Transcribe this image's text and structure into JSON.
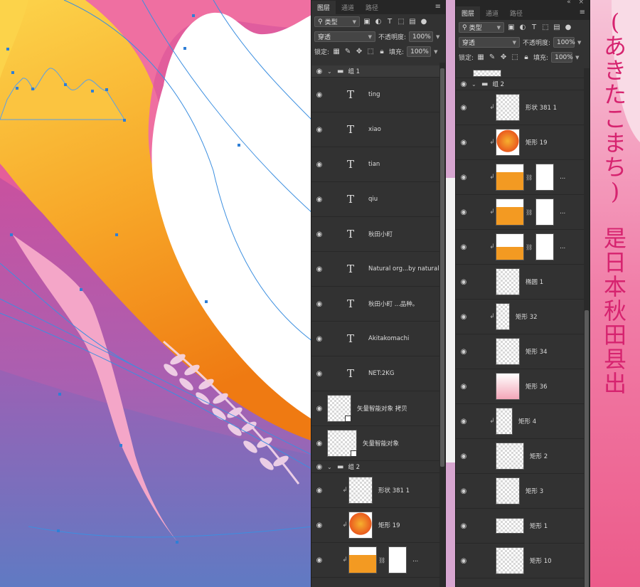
{
  "colors": {
    "accent_text": "#d6236f",
    "panel_bg": "#323232"
  },
  "left_panel": {
    "tabs": [
      "图层",
      "通道",
      "路径"
    ],
    "filter_kind": "类型",
    "blend_mode": "穿透",
    "opacity_label": "不透明度:",
    "opacity_value": "100%",
    "lock_label": "锁定:",
    "fill_label": "填充:",
    "fill_value": "100%",
    "group1_name": "组 1",
    "text_layers": [
      "ting",
      "xiao",
      "tian",
      "qiu",
      "秋田小町",
      "Natural org...by natural",
      "秋田小町 ...品种。",
      "Akitakomachi",
      "NET:2KG"
    ],
    "smart_layers": [
      "矢量智能对象 拷贝",
      "矢量智能对象"
    ],
    "group2_name": "组 2",
    "group2_layers": [
      {
        "name": "形状 381 1"
      },
      {
        "name": "矩形 19"
      },
      {
        "name": "..."
      }
    ]
  },
  "right_panel": {
    "tabs": [
      "图层",
      "通道",
      "路径"
    ],
    "filter_kind": "类型",
    "blend_mode": "穿透",
    "opacity_label": "不透明度:",
    "opacity_value": "100%",
    "lock_label": "锁定:",
    "fill_label": "填充:",
    "fill_value": "100%",
    "group2_name": "组 2",
    "layers": [
      {
        "name": "形状 381 1"
      },
      {
        "name": "矩形 19"
      },
      {
        "name": "..."
      },
      {
        "name": "..."
      },
      {
        "name": "..."
      },
      {
        "name": "椭圆 1"
      },
      {
        "name": "矩形 32"
      },
      {
        "name": "矩形 34"
      },
      {
        "name": "矩形 36"
      },
      {
        "name": "矩形 4"
      },
      {
        "name": "矩形 2"
      },
      {
        "name": "矩形 3"
      },
      {
        "name": "矩形 1"
      },
      {
        "name": "矩形 10"
      }
    ]
  },
  "side_text": {
    "line1": [
      "(",
      "あ",
      "き",
      "た",
      "こ",
      "ま",
      "ち",
      ")"
    ],
    "line2": [
      "是",
      "日",
      "本",
      "秋",
      "田",
      "县",
      "出"
    ]
  }
}
